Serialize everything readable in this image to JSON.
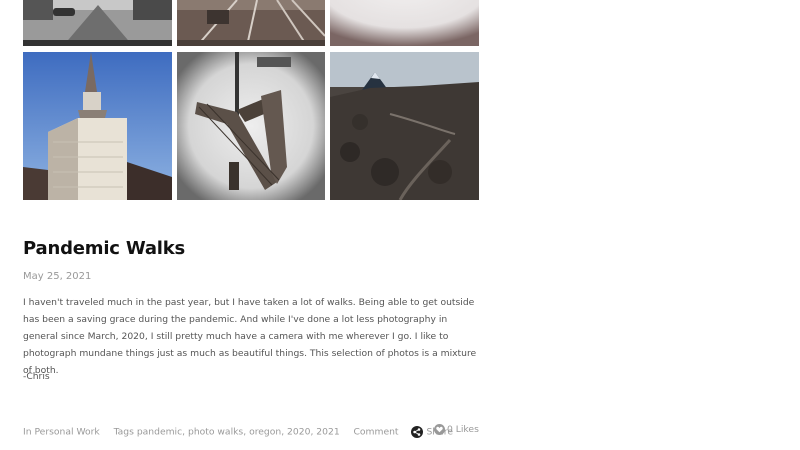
{
  "gallery": {
    "photos": [
      {
        "name": "street-photo"
      },
      {
        "name": "tracks-photo"
      },
      {
        "name": "fog-photo"
      },
      {
        "name": "church-steeple-photo"
      },
      {
        "name": "bench-photo"
      },
      {
        "name": "lava-field-photo"
      }
    ]
  },
  "post": {
    "title": "Pandemic Walks",
    "date": "May 25, 2021",
    "body": "I haven't traveled much in the past year, but I have taken a lot of walks. Being able to get outside has been a saving grace during the pandemic. And while I've done a lot less photography in general since March, 2020, I still pretty much have a camera with me wherever I go. I like to photograph mundane things just as much as beautiful things. This selection of photos is a mixture of both.",
    "signature": "-Chris"
  },
  "meta": {
    "in_prefix": "In",
    "category": "Personal Work",
    "tags_prefix": "Tags",
    "tags": [
      "pandemic",
      "photo walks",
      "oregon",
      "2020",
      "2021"
    ],
    "comment": "Comment",
    "share": "Share",
    "likes": "0 Likes"
  }
}
